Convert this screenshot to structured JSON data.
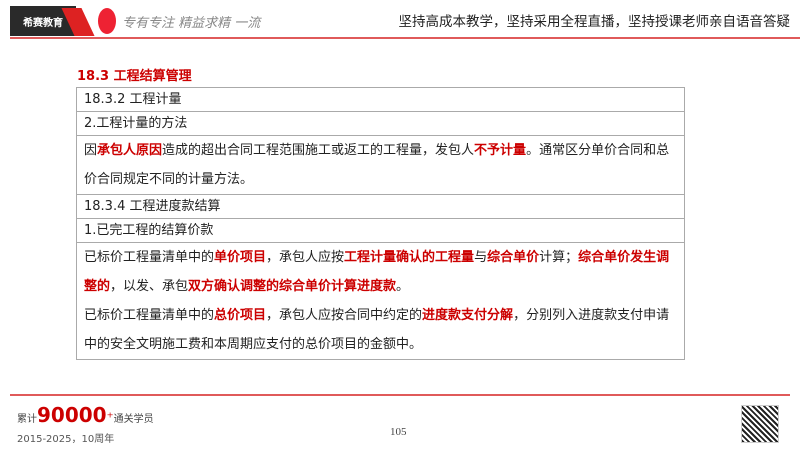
{
  "header": {
    "logo_text": "希赛教育",
    "motto": "专有专注 精益求精 一流",
    "slogan": "坚持高成本教学，坚持采用全程直播，坚持授课老师亲自语音答疑"
  },
  "section_title": "18.3 工程结算管理",
  "rows": {
    "r1": "18.3.2 工程计量",
    "r2": "2.工程计量的方法",
    "r3": {
      "a": "因",
      "b": "承包人原因",
      "c": "造成的超出合同工程范围施工或返工的工程量，发包人",
      "d": "不予计量",
      "e": "。通常区分单价合同和总价合同规定不同的计量方法。"
    },
    "r4": "18.3.4 工程进度款结算",
    "r5": "1.已完工程的结算价款",
    "r6": {
      "a": "已标价工程量清单中的",
      "b": "单价项目",
      "c": "，承包人应按",
      "d": "工程计量确认的工程量",
      "e": "与",
      "f": "综合单价",
      "g": "计算；",
      "h": "综合单价发生调整的",
      "i": "，以发、承包",
      "j": "双方确认调整的综合单价计算进度款",
      "k": "。",
      "l": "已标价工程量清单中的",
      "m": "总价项目",
      "n": "，承包人应按合同中约定的",
      "o": "进度款支付分解",
      "p": "，分别列入进度款支付申请中的安全文明施工费和本周期应支付的总价项目的金额中。"
    }
  },
  "footer": {
    "prefix": "累计",
    "count": "90000",
    "plus": "+",
    "suffix": "通关学员",
    "years": "2015-2025，10周年",
    "page": "105"
  },
  "colors": {
    "accent": "#cc0000"
  }
}
